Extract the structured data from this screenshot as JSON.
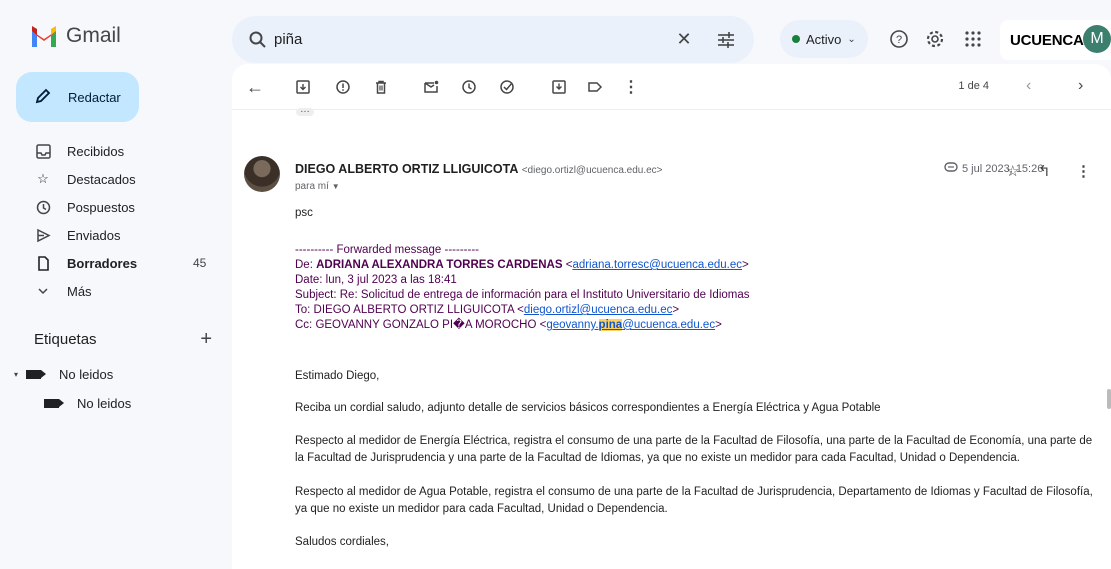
{
  "app": {
    "name": "Gmail"
  },
  "search": {
    "value": "piña"
  },
  "status": {
    "label": "Activo"
  },
  "brand": {
    "name": "UCUENCA"
  },
  "account": {
    "initial": "M"
  },
  "compose": {
    "label": "Redactar"
  },
  "sidebar": {
    "items": [
      {
        "label": "Recibidos",
        "count": ""
      },
      {
        "label": "Destacados",
        "count": ""
      },
      {
        "label": "Pospuestos",
        "count": ""
      },
      {
        "label": "Enviados",
        "count": ""
      },
      {
        "label": "Borradores",
        "count": "45"
      },
      {
        "label": "Más",
        "count": ""
      }
    ],
    "labels_title": "Etiquetas",
    "labels": [
      "No leidos",
      "No leidos"
    ]
  },
  "toolbar": {
    "pager": "1 de 4"
  },
  "message": {
    "sender_name": "DIEGO ALBERTO ORTIZ LLIGUICOTA",
    "sender_email": "<diego.ortizl@ucuenca.edu.ec>",
    "to": "para mí",
    "date": "5 jul 2023, 15:26",
    "body": {
      "line1": "psc",
      "fwd_header": "---------- Forwarded message ---------",
      "from_prefix": "De: ",
      "from_name": "ADRIANA ALEXANDRA TORRES CARDENAS",
      "from_lt": " <",
      "from_email": "adriana.torresc@ucuenca.edu.ec",
      "from_gt": ">",
      "date_line": "Date: lun, 3 jul 2023 a las 18:41",
      "subject_line": "Subject: Re: Solicitud de entrega de información para el Instituto Universitario de Idiomas",
      "to_prefix": "To: DIEGO ALBERTO ORTIZ LLIGUICOTA <",
      "to_email": "diego.ortizl@ucuenca.edu.ec",
      "to_gt": ">",
      "cc_prefix": "Cc: GEOVANNY GONZALO PI�A MOROCHO <",
      "cc_email_a": "geovanny.",
      "cc_email_hl": "pina",
      "cc_email_b": "@ucuenca.edu.ec",
      "cc_gt": ">",
      "greeting": "Estimado Diego,",
      "p1": "Reciba un cordial saludo, adjunto detalle de servicios básicos correspondientes a Energía Eléctrica y Agua Potable",
      "p2": "Respecto al medidor de Energía Eléctrica, registra el consumo de una parte de la Facultad de Filosofía, una parte de la Facultad de Economía, una parte de la Facultad de Jurisprudencia y una parte de la Facultad de Idiomas,  ya que no existe un medidor para cada Facultad, Unidad o Dependencia.",
      "p3": "Respecto al medidor de Agua Potable, registra el consumo de una parte de la Facultad de Jurisprudencia, Departamento de Idiomas y Facultad de Filosofía, ya que no existe un medidor para cada Facultad, Unidad o Dependencia.",
      "closing": "Saludos cordiales,"
    }
  },
  "icons": [
    "menu-icon",
    "gmail-logo-icon",
    "search-icon",
    "clear-icon",
    "filter-icon",
    "help-icon",
    "settings-icon",
    "apps-icon",
    "inbox-icon",
    "star-icon",
    "snooze-icon",
    "send-icon",
    "draft-icon",
    "expand-icon",
    "label-icon",
    "back-icon",
    "archive-icon",
    "report-icon",
    "delete-icon",
    "mark-unread-icon",
    "snooze-action-icon",
    "add-task-icon",
    "move-icon",
    "label-action-icon",
    "more-icon",
    "prev-icon",
    "next-icon",
    "label-tag-icon",
    "reply-icon"
  ],
  "colors": {
    "compose_bg": "#c2e7ff",
    "search_bg": "#eaf1fb",
    "status_dot": "#188038",
    "link": "#1155cc",
    "highlight": "#fcd361"
  }
}
